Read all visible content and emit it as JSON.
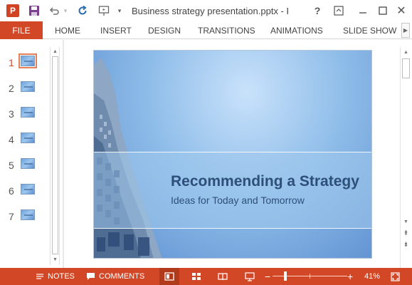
{
  "titlebar": {
    "app_logo_letter": "P",
    "document_title": "Business strategy presentation.pptx - PowerPoint",
    "help_label": "?",
    "icons": [
      "powerpoint-logo-icon",
      "save-icon",
      "undo-icon",
      "refresh-icon",
      "start-from-beginning-icon",
      "customize-qat-icon",
      "help-icon",
      "ribbon-display-options-icon",
      "minimize-icon",
      "maximize-icon",
      "close-icon"
    ]
  },
  "ribbon": {
    "file_label": "FILE",
    "tabs": [
      "HOME",
      "INSERT",
      "DESIGN",
      "TRANSITIONS",
      "ANIMATIONS",
      "SLIDE SHOW"
    ],
    "scroll_right_icon": "chevron-right-icon"
  },
  "thumbnails": {
    "selected": 1,
    "items": [
      "1",
      "2",
      "3",
      "4",
      "5",
      "6",
      "7"
    ]
  },
  "slide": {
    "title": "Recommending a Strategy",
    "subtitle": "Ideas for Today and Tomorrow"
  },
  "statusbar": {
    "notes_label": "NOTES",
    "comments_label": "COMMENTS",
    "zoom_percent": "41%",
    "zoom_minus": "−",
    "zoom_plus": "+",
    "zoom_fraction": 0.41
  },
  "colors": {
    "accent": "#D24726",
    "slide_title": "#2D4F78",
    "slide_background": "#8FBDE9"
  }
}
